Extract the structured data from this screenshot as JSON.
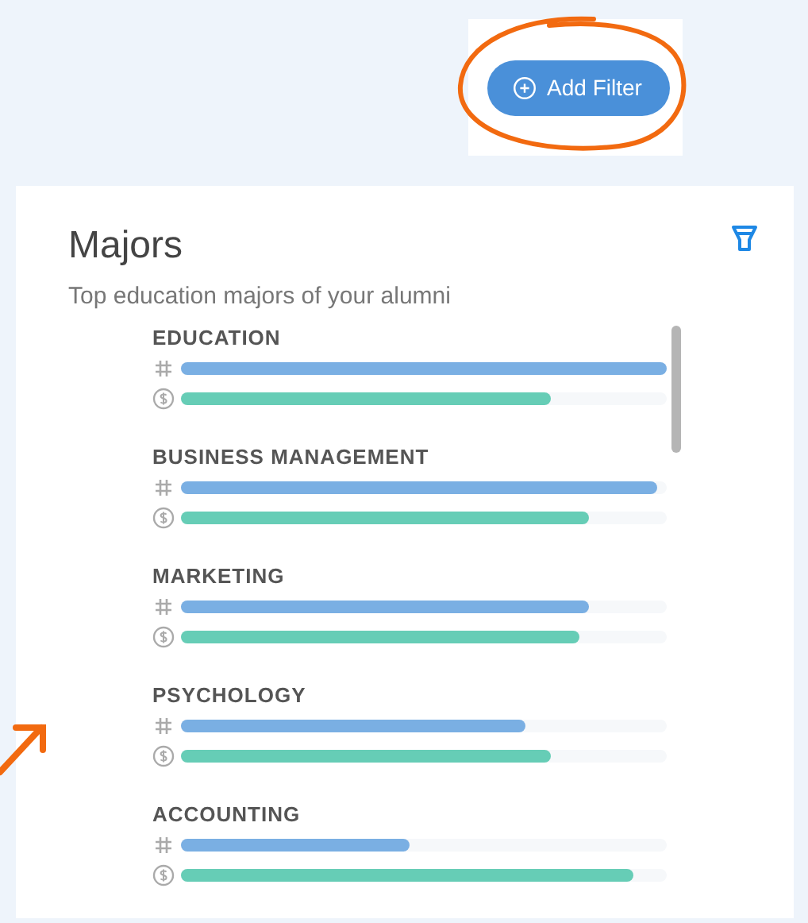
{
  "add_filter_button": {
    "label": "Add Filter"
  },
  "card": {
    "title": "Majors",
    "subtitle": "Top education majors of your alumni",
    "majors": [
      {
        "name": "EDUCATION",
        "count": {
          "level": 1.0
        },
        "salary": {
          "level": 0.76
        }
      },
      {
        "name": "BUSINESS MANAGEMENT",
        "count": {
          "level": 0.98
        },
        "salary": {
          "level": 0.84
        }
      },
      {
        "name": "MARKETING",
        "count": {
          "level": 0.84
        },
        "salary": {
          "level": 0.82
        }
      },
      {
        "name": "PSYCHOLOGY",
        "count": {
          "level": 0.71
        },
        "salary": {
          "level": 0.76
        }
      },
      {
        "name": "ACCOUNTING",
        "count": {
          "level": 0.47
        },
        "salary": {
          "level": 0.93
        }
      }
    ]
  }
}
